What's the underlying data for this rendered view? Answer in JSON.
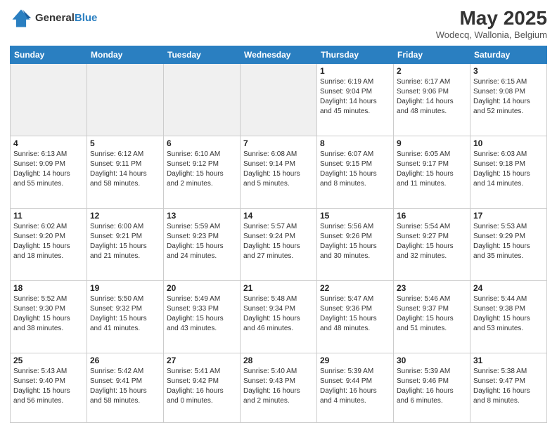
{
  "header": {
    "logo_general": "General",
    "logo_blue": "Blue",
    "month_year": "May 2025",
    "location": "Wodecq, Wallonia, Belgium"
  },
  "days_of_week": [
    "Sunday",
    "Monday",
    "Tuesday",
    "Wednesday",
    "Thursday",
    "Friday",
    "Saturday"
  ],
  "weeks": [
    [
      {
        "day": "",
        "info": "",
        "shaded": true
      },
      {
        "day": "",
        "info": "",
        "shaded": true
      },
      {
        "day": "",
        "info": "",
        "shaded": true
      },
      {
        "day": "",
        "info": "",
        "shaded": true
      },
      {
        "day": "1",
        "info": "Sunrise: 6:19 AM\nSunset: 9:04 PM\nDaylight: 14 hours\nand 45 minutes.",
        "shaded": false
      },
      {
        "day": "2",
        "info": "Sunrise: 6:17 AM\nSunset: 9:06 PM\nDaylight: 14 hours\nand 48 minutes.",
        "shaded": false
      },
      {
        "day": "3",
        "info": "Sunrise: 6:15 AM\nSunset: 9:08 PM\nDaylight: 14 hours\nand 52 minutes.",
        "shaded": false
      }
    ],
    [
      {
        "day": "4",
        "info": "Sunrise: 6:13 AM\nSunset: 9:09 PM\nDaylight: 14 hours\nand 55 minutes.",
        "shaded": false
      },
      {
        "day": "5",
        "info": "Sunrise: 6:12 AM\nSunset: 9:11 PM\nDaylight: 14 hours\nand 58 minutes.",
        "shaded": false
      },
      {
        "day": "6",
        "info": "Sunrise: 6:10 AM\nSunset: 9:12 PM\nDaylight: 15 hours\nand 2 minutes.",
        "shaded": false
      },
      {
        "day": "7",
        "info": "Sunrise: 6:08 AM\nSunset: 9:14 PM\nDaylight: 15 hours\nand 5 minutes.",
        "shaded": false
      },
      {
        "day": "8",
        "info": "Sunrise: 6:07 AM\nSunset: 9:15 PM\nDaylight: 15 hours\nand 8 minutes.",
        "shaded": false
      },
      {
        "day": "9",
        "info": "Sunrise: 6:05 AM\nSunset: 9:17 PM\nDaylight: 15 hours\nand 11 minutes.",
        "shaded": false
      },
      {
        "day": "10",
        "info": "Sunrise: 6:03 AM\nSunset: 9:18 PM\nDaylight: 15 hours\nand 14 minutes.",
        "shaded": false
      }
    ],
    [
      {
        "day": "11",
        "info": "Sunrise: 6:02 AM\nSunset: 9:20 PM\nDaylight: 15 hours\nand 18 minutes.",
        "shaded": false
      },
      {
        "day": "12",
        "info": "Sunrise: 6:00 AM\nSunset: 9:21 PM\nDaylight: 15 hours\nand 21 minutes.",
        "shaded": false
      },
      {
        "day": "13",
        "info": "Sunrise: 5:59 AM\nSunset: 9:23 PM\nDaylight: 15 hours\nand 24 minutes.",
        "shaded": false
      },
      {
        "day": "14",
        "info": "Sunrise: 5:57 AM\nSunset: 9:24 PM\nDaylight: 15 hours\nand 27 minutes.",
        "shaded": false
      },
      {
        "day": "15",
        "info": "Sunrise: 5:56 AM\nSunset: 9:26 PM\nDaylight: 15 hours\nand 30 minutes.",
        "shaded": false
      },
      {
        "day": "16",
        "info": "Sunrise: 5:54 AM\nSunset: 9:27 PM\nDaylight: 15 hours\nand 32 minutes.",
        "shaded": false
      },
      {
        "day": "17",
        "info": "Sunrise: 5:53 AM\nSunset: 9:29 PM\nDaylight: 15 hours\nand 35 minutes.",
        "shaded": false
      }
    ],
    [
      {
        "day": "18",
        "info": "Sunrise: 5:52 AM\nSunset: 9:30 PM\nDaylight: 15 hours\nand 38 minutes.",
        "shaded": false
      },
      {
        "day": "19",
        "info": "Sunrise: 5:50 AM\nSunset: 9:32 PM\nDaylight: 15 hours\nand 41 minutes.",
        "shaded": false
      },
      {
        "day": "20",
        "info": "Sunrise: 5:49 AM\nSunset: 9:33 PM\nDaylight: 15 hours\nand 43 minutes.",
        "shaded": false
      },
      {
        "day": "21",
        "info": "Sunrise: 5:48 AM\nSunset: 9:34 PM\nDaylight: 15 hours\nand 46 minutes.",
        "shaded": false
      },
      {
        "day": "22",
        "info": "Sunrise: 5:47 AM\nSunset: 9:36 PM\nDaylight: 15 hours\nand 48 minutes.",
        "shaded": false
      },
      {
        "day": "23",
        "info": "Sunrise: 5:46 AM\nSunset: 9:37 PM\nDaylight: 15 hours\nand 51 minutes.",
        "shaded": false
      },
      {
        "day": "24",
        "info": "Sunrise: 5:44 AM\nSunset: 9:38 PM\nDaylight: 15 hours\nand 53 minutes.",
        "shaded": false
      }
    ],
    [
      {
        "day": "25",
        "info": "Sunrise: 5:43 AM\nSunset: 9:40 PM\nDaylight: 15 hours\nand 56 minutes.",
        "shaded": false
      },
      {
        "day": "26",
        "info": "Sunrise: 5:42 AM\nSunset: 9:41 PM\nDaylight: 15 hours\nand 58 minutes.",
        "shaded": false
      },
      {
        "day": "27",
        "info": "Sunrise: 5:41 AM\nSunset: 9:42 PM\nDaylight: 16 hours\nand 0 minutes.",
        "shaded": false
      },
      {
        "day": "28",
        "info": "Sunrise: 5:40 AM\nSunset: 9:43 PM\nDaylight: 16 hours\nand 2 minutes.",
        "shaded": false
      },
      {
        "day": "29",
        "info": "Sunrise: 5:39 AM\nSunset: 9:44 PM\nDaylight: 16 hours\nand 4 minutes.",
        "shaded": false
      },
      {
        "day": "30",
        "info": "Sunrise: 5:39 AM\nSunset: 9:46 PM\nDaylight: 16 hours\nand 6 minutes.",
        "shaded": false
      },
      {
        "day": "31",
        "info": "Sunrise: 5:38 AM\nSunset: 9:47 PM\nDaylight: 16 hours\nand 8 minutes.",
        "shaded": false
      }
    ]
  ]
}
